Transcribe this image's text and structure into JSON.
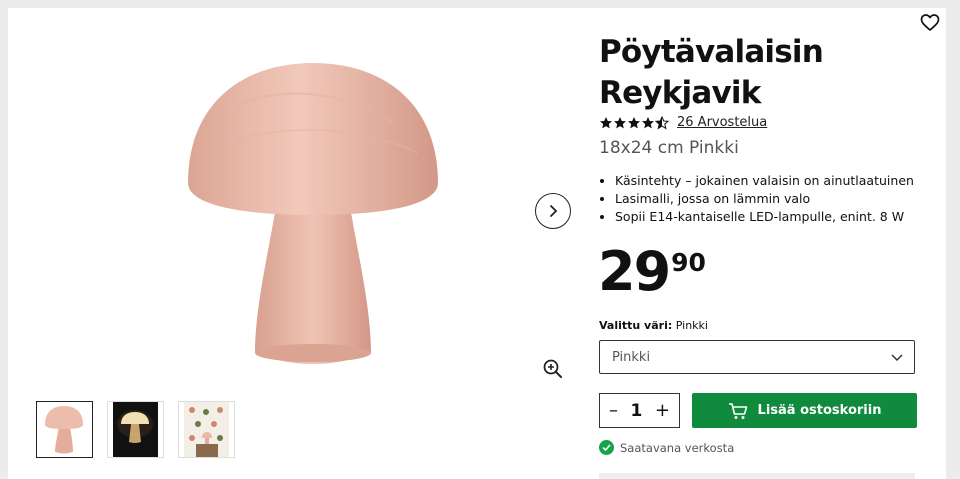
{
  "product": {
    "title": "Pöytävalaisin Reykjavik",
    "rating_value": 4.5,
    "reviews_text": "26 Arvostelua",
    "variant": "18x24 cm Pinkki",
    "features": [
      "Käsintehty – jokainen valaisin on ainutlaatuinen",
      "Lasimalli, jossa on lämmin valo",
      "Sopii E14-kantaiselle LED-lampulle, enint. 8 W"
    ],
    "price_integer": "29",
    "price_decimal": "90"
  },
  "color": {
    "label": "Valittu väri:",
    "selected": "Pinkki",
    "options_selected": "Pinkki"
  },
  "quantity": {
    "minus": "–",
    "value": "1",
    "plus": "+"
  },
  "cart": {
    "button_label": "Lisää ostoskoriin"
  },
  "availability": {
    "text": "Saatavana verkosta"
  },
  "icons": {
    "favorite": "heart-icon",
    "next": "chevron-right-icon",
    "zoom": "zoom-in-icon",
    "dropdown": "chevron-down-icon",
    "cart": "cart-icon",
    "availability": "check-circle-icon"
  },
  "colors": {
    "lamp_pink": "#e8b8a8",
    "cart_green": "#108a3c",
    "availability_green": "#17a34a"
  },
  "gallery": {
    "thumbnail_count": 3,
    "active_thumbnail": 1
  }
}
